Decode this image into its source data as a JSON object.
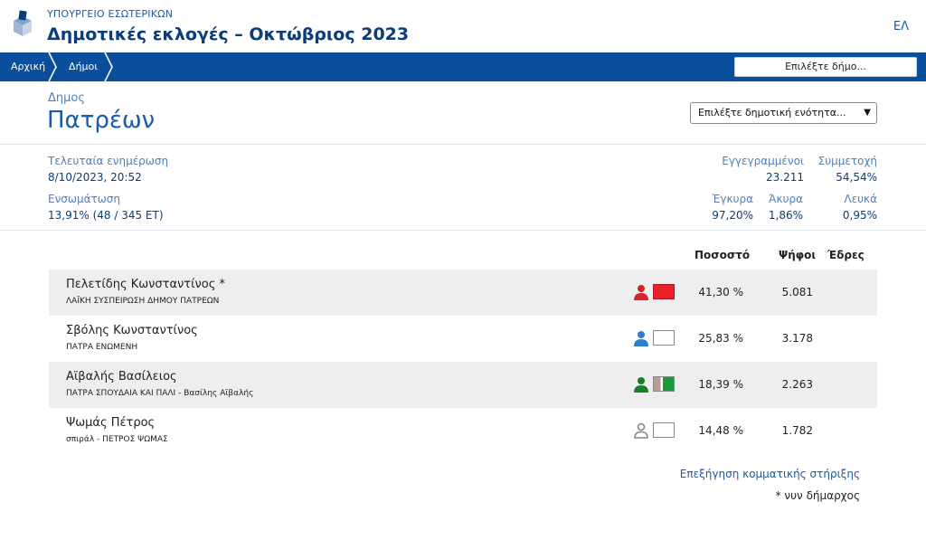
{
  "header": {
    "ministry": "ΥΠΟΥΡΓΕΙΟ ΕΣΩΤΕΡΙΚΩΝ",
    "title": "Δημοτικές εκλογές – Οκτώβριος 2023",
    "lang": "ΕΛ"
  },
  "nav": {
    "home": "Αρχική",
    "dimoi": "Δήμοι",
    "select_placeholder": "Επιλέξτε δήμο..."
  },
  "municipality": {
    "kind": "Δημος",
    "name": "Πατρέων",
    "unit_select": "Επιλέξτε δημοτική ενότητα..."
  },
  "stats": {
    "last_update_label": "Τελευταία ενημέρωση",
    "last_update_value": "8/10/2023, 20:52",
    "integration_label": "Ενσωμάτωση",
    "integration_value": "13,91% (48 / 345 ΕΤ)",
    "registered_label": "Εγγεγραμμένοι",
    "registered_value": "23.211",
    "turnout_label": "Συμμετοχή",
    "turnout_value": "54,54%",
    "valid_label": "Έγκυρα",
    "valid_value": "97,20%",
    "invalid_label": "Άκυρα",
    "invalid_value": "1,86%",
    "blank_label": "Λευκά",
    "blank_value": "0,95%"
  },
  "results": {
    "col_percent": "Ποσοστό",
    "col_votes": "Ψήφοι",
    "col_seats": "Έδρες",
    "rows": [
      {
        "candidate": "Πελετίδης Κωνσταντίνος *",
        "party": "ΛΑΪΚΗ ΣΥΣΠΕΙΡΩΣΗ ΔΗΜΟΥ ΠΑΤΡΕΩΝ",
        "percent": "41,30 %",
        "votes": "5.081",
        "icon_color": "#d9232e",
        "swatch": "#e8202a"
      },
      {
        "candidate": "Σβόλης Κωνσταντίνος",
        "party": "ΠΑΤΡΑ ΕΝΩΜΕΝΗ",
        "percent": "25,83 %",
        "votes": "3.178",
        "icon_color": "#2a7fd1",
        "swatch": "#ffffff"
      },
      {
        "candidate": "Αϊβαλής Βασίλειος",
        "party": "ΠΑΤΡΑ ΣΠΟΥΔΑΙΑ ΚΑΙ ΠΑΛΙ - Βασίλης Αϊβαλής",
        "percent": "18,39 %",
        "votes": "2.263",
        "icon_color": "#14802a",
        "swatch": "#1a9a3a"
      },
      {
        "candidate": "Ψωμάς Πέτρος",
        "party": "σπιράλ - ΠΕΤΡΟΣ ΨΩΜΑΣ",
        "percent": "14,48 %",
        "votes": "1.782",
        "icon_color": "#888888",
        "swatch": "#ffffff"
      }
    ],
    "explain_link": "Επεξήγηση κομματικής στήριξης",
    "note": "* νυν δήμαρχος"
  }
}
